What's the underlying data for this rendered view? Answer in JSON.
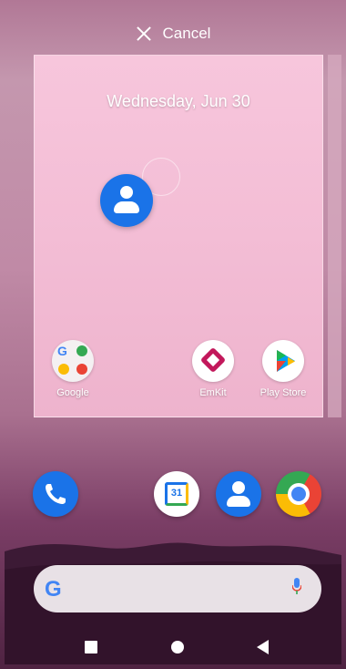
{
  "cancel_label": "Cancel",
  "widget": {
    "date": "Wednesday, Jun 30"
  },
  "preview_apps": [
    {
      "label": "Google"
    },
    {
      "label": "EmKit"
    },
    {
      "label": "Play Store"
    }
  ],
  "dock": [
    "phone-icon",
    "calendar-icon",
    "contacts-icon",
    "chrome-icon"
  ],
  "calendar_day": "31",
  "search": {
    "logo": "G"
  },
  "colors": {
    "accent_blue": "#1a73e8",
    "google_red": "#ea4335",
    "google_yellow": "#fbbc05",
    "google_green": "#34a853"
  }
}
